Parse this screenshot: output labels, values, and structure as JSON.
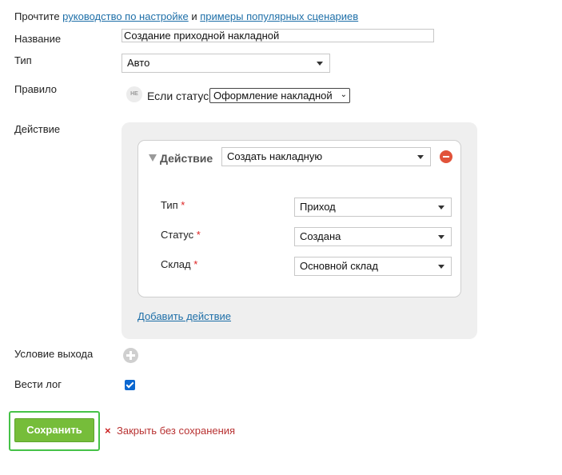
{
  "intro": {
    "prefix": "Прочтите",
    "link1": "руководство по настройке",
    "conj": "и",
    "link2": "примеры популярных сценариев"
  },
  "form": {
    "name_label": "Название",
    "name_value": "Создание приходной накладной",
    "type_label": "Тип",
    "type_value": "Авто",
    "rule_label": "Правило",
    "rule_badge": "НЕ",
    "rule_text": "Если статус",
    "rule_value": "Оформление накладной",
    "action_label": "Действие",
    "exit_label": "Условие выхода",
    "log_label": "Вести лог",
    "log_checked": true
  },
  "action": {
    "title": "Действие",
    "value": "Создать накладную",
    "fields": [
      {
        "label": "Тип",
        "required": "*",
        "value": "Приход"
      },
      {
        "label": "Статус",
        "required": "*",
        "value": "Создана"
      },
      {
        "label": "Склад",
        "required": "*",
        "value": "Основной склад"
      }
    ],
    "add_label": "Добавить действие"
  },
  "footer": {
    "save_label": "Сохранить",
    "close_icon": "×",
    "close_label": "Закрыть без сохранения"
  },
  "colors": {
    "link": "#1e6fa8",
    "save_button": "#76bd3a",
    "highlight": "#45c247",
    "remove": "#e1533a",
    "close_text": "#b83232"
  }
}
